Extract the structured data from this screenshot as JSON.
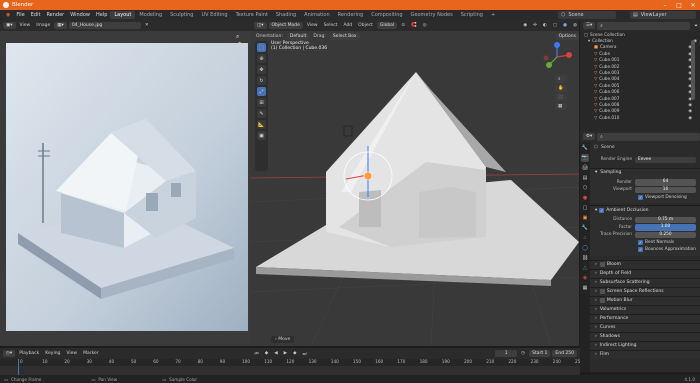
{
  "app": {
    "title": "Blender"
  },
  "menu": [
    "File",
    "Edit",
    "Render",
    "Window",
    "Help"
  ],
  "workspaces": [
    "Layout",
    "Modeling",
    "Sculpting",
    "UV Editing",
    "Texture Paint",
    "Shading",
    "Animation",
    "Rendering",
    "Compositing",
    "Geometry Nodes",
    "Scripting"
  ],
  "scene": {
    "name": "Scene",
    "view_layer": "ViewLayer"
  },
  "image_editor": {
    "menus": [
      "View",
      "Image"
    ],
    "image_name": "04_House.jpg"
  },
  "viewport": {
    "mode": "Object Mode",
    "menus": [
      "View",
      "Select",
      "Add",
      "Object"
    ],
    "transform": "Global",
    "orientation_label": "Orientation:",
    "orientation_value": "Default",
    "drag_label": "Drag:",
    "drag_value": "Select Box",
    "options_label": "Options",
    "overlay_line1": "User Perspective",
    "overlay_line2": "(1) Collection | Cube.036",
    "last_op": "Move"
  },
  "outliner": {
    "root": "Scene Collection",
    "collection": "Collection",
    "items": [
      "Camera",
      "Cube",
      "Cube.001",
      "Cube.002",
      "Cube.003",
      "Cube.004",
      "Cube.005",
      "Cube.006",
      "Cube.007",
      "Cube.008",
      "Cube.009",
      "Cube.010"
    ]
  },
  "properties": {
    "scene_name": "Scene",
    "render_engine_label": "Render Engine",
    "render_engine_value": "Eevee",
    "sampling": {
      "title": "Sampling",
      "render_label": "Render",
      "render_value": "64",
      "viewport_label": "Viewport",
      "viewport_value": "16",
      "denoise_label": "Viewport Denoising"
    },
    "ao": {
      "title": "Ambient Occlusion",
      "distance_label": "Distance",
      "distance_value": "0.75 m",
      "factor_label": "Factor",
      "factor_value": "1.00",
      "precision_label": "Trace Precision",
      "precision_value": "0.250",
      "bent_label": "Bent Normals",
      "bounce_label": "Bounces Approximation"
    },
    "sections": [
      "Bloom",
      "Depth of Field",
      "Subsurface Scattering",
      "Screen Space Reflections",
      "Motion Blur",
      "Volumetrics",
      "Performance",
      "Curves",
      "Shadows",
      "Indirect Lighting",
      "Film"
    ]
  },
  "timeline": {
    "menus": [
      "Playback",
      "Keying",
      "View",
      "Marker"
    ],
    "current_frame": "1",
    "start_label": "Start",
    "start_value": "1",
    "end_label": "End",
    "end_value": "250",
    "ticks": [
      "0",
      "10",
      "20",
      "30",
      "40",
      "50",
      "60",
      "70",
      "80",
      "90",
      "100",
      "110",
      "120",
      "130",
      "140",
      "150",
      "160",
      "170",
      "180",
      "190",
      "200",
      "210",
      "220",
      "230",
      "240",
      "250"
    ]
  },
  "statusbar": {
    "hint1": "Change Frame",
    "hint2": "Pan View",
    "hint3": "Sample Color",
    "version": "4.1.0"
  },
  "colors": {
    "accent": "#e8651e",
    "select_blue": "#4772b3",
    "object_orange": "#ff9b3d"
  }
}
